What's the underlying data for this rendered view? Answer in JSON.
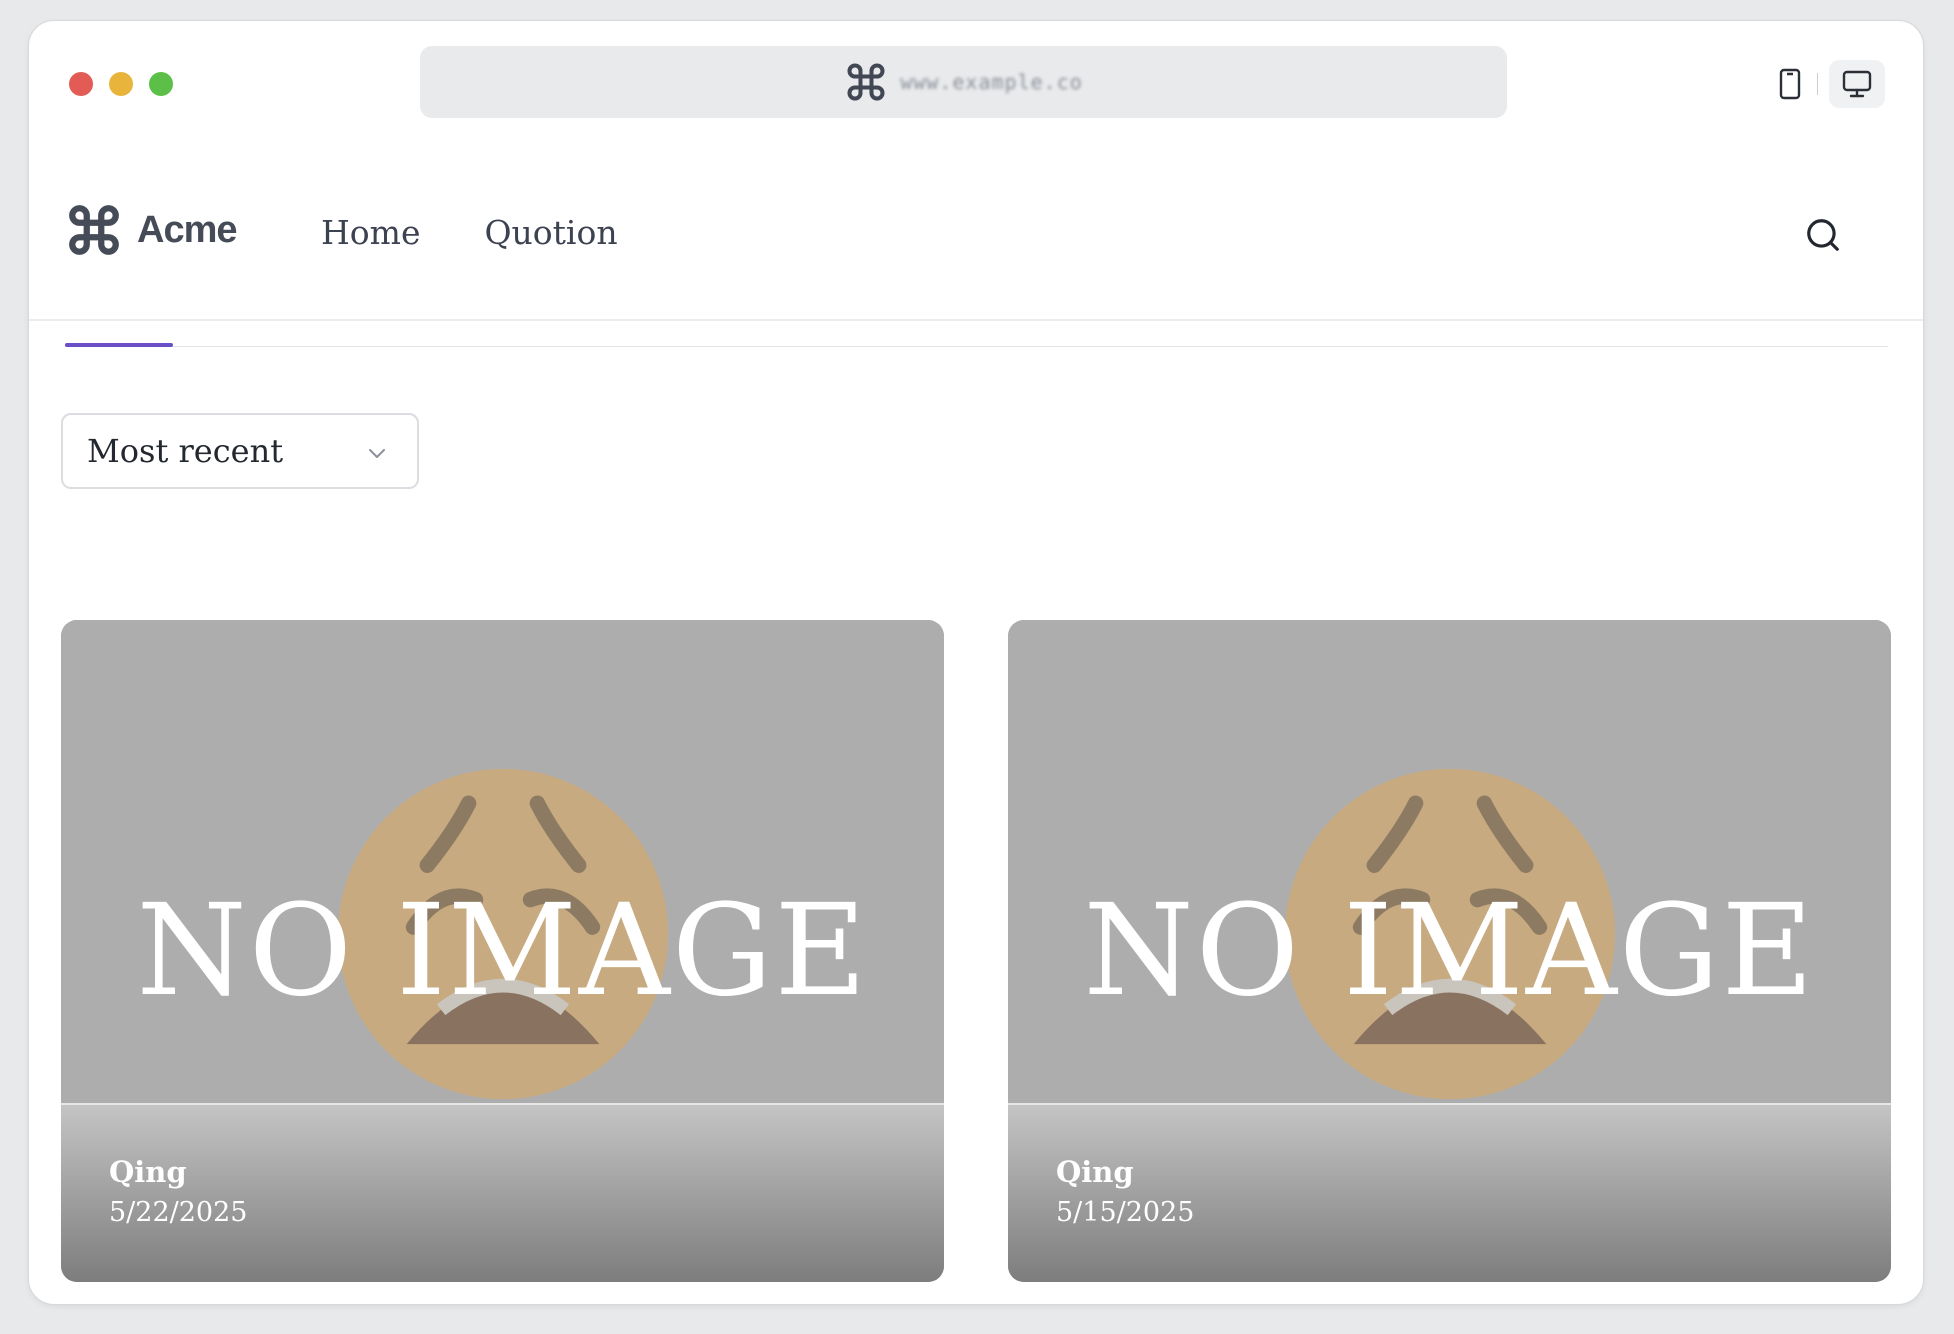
{
  "browser": {
    "url_text": "www.example.co"
  },
  "site": {
    "logo_text": "Acme",
    "nav": [
      {
        "label": "Home"
      },
      {
        "label": "Quotion"
      }
    ]
  },
  "sort": {
    "selected": "Most recent"
  },
  "posts": [
    {
      "image_placeholder": "NO IMAGE",
      "author": "Qing",
      "date": "5/22/2025"
    },
    {
      "image_placeholder": "NO IMAGE",
      "author": "Qing",
      "date": "5/15/2025"
    }
  ],
  "colors": {
    "accent": "#6a4fc9",
    "traffic_red": "#e25c55",
    "traffic_yellow": "#e9b43c",
    "traffic_green": "#5cbf47"
  }
}
